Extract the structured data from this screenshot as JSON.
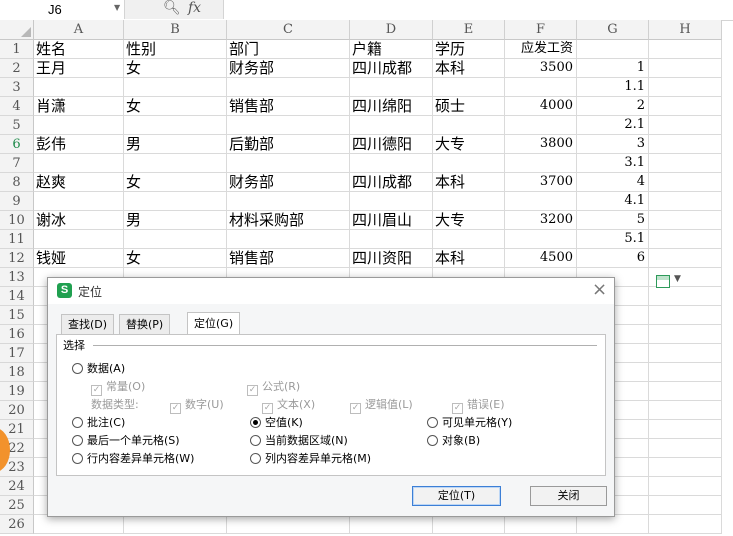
{
  "formula_bar": {
    "name_box": "J6",
    "zoom_icon": "magnifier-icon",
    "fx_label": "fx"
  },
  "columns": [
    "A",
    "B",
    "C",
    "D",
    "E",
    "F",
    "G",
    "H"
  ],
  "rows": [
    "1",
    "2",
    "3",
    "4",
    "5",
    "6",
    "7",
    "8",
    "9",
    "10",
    "11",
    "12",
    "13",
    "14",
    "15",
    "16",
    "17",
    "18",
    "19",
    "20",
    "21",
    "22",
    "23",
    "24",
    "25",
    "26"
  ],
  "selected_row": "6",
  "cells": {
    "r1": [
      "姓名",
      "性别",
      "部门",
      "户籍",
      "学历",
      "应发工资",
      "",
      ""
    ],
    "r2": [
      "王月",
      "女",
      "财务部",
      "四川成都",
      "本科",
      "3500",
      "1",
      ""
    ],
    "r3": [
      "",
      "",
      "",
      "",
      "",
      "",
      "1.1",
      ""
    ],
    "r4": [
      "肖潇",
      "女",
      "销售部",
      "四川绵阳",
      "硕士",
      "4000",
      "2",
      ""
    ],
    "r5": [
      "",
      "",
      "",
      "",
      "",
      "",
      "2.1",
      ""
    ],
    "r6": [
      "彭伟",
      "男",
      "后勤部",
      "四川德阳",
      "大专",
      "3800",
      "3",
      ""
    ],
    "r7": [
      "",
      "",
      "",
      "",
      "",
      "",
      "3.1",
      ""
    ],
    "r8": [
      "赵爽",
      "女",
      "财务部",
      "四川成都",
      "本科",
      "3700",
      "4",
      ""
    ],
    "r9": [
      "",
      "",
      "",
      "",
      "",
      "",
      "4.1",
      ""
    ],
    "r10": [
      "谢冰",
      "男",
      "材料采购部",
      "四川眉山",
      "大专",
      "3200",
      "5",
      ""
    ],
    "r11": [
      "",
      "",
      "",
      "",
      "",
      "",
      "5.1",
      ""
    ],
    "r12": [
      "钱娅",
      "女",
      "销售部",
      "四川资阳",
      "本科",
      "4500",
      "6",
      ""
    ]
  },
  "dialog": {
    "logo": "S",
    "title": "定位",
    "close": "×",
    "tabs": [
      "查找(D)",
      "替换(P)",
      "定位(G)"
    ],
    "active_tab": "定位(G)",
    "group_label": "选择",
    "options": {
      "data": "数据(A)",
      "constant": "常量(O)",
      "formula": "公式(R)",
      "data_type_label": "数据类型:",
      "number": "数字(U)",
      "text": "文本(X)",
      "logical": "逻辑值(L)",
      "error": "错误(E)",
      "comment": "批注(C)",
      "blank": "空值(K)",
      "visible_cells": "可见单元格(Y)",
      "last_cell": "最后一个单元格(S)",
      "current_region": "当前数据区域(N)",
      "objects": "对象(B)",
      "row_diff": "行内容差异单元格(W)",
      "col_diff": "列内容差异单元格(M)"
    },
    "selected_option": "空值(K)",
    "ok_button": "定位(T)",
    "close_button": "关闭"
  }
}
